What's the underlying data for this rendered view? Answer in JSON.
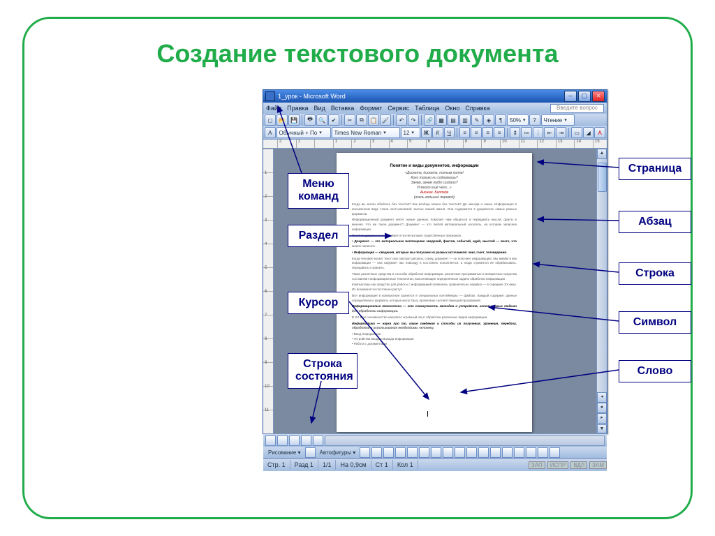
{
  "slide": {
    "title": "Создание текстового документа"
  },
  "word": {
    "title": "1_урок - Microsoft Word",
    "menu": {
      "file": "Файл",
      "edit": "Правка",
      "view": "Вид",
      "insert": "Вставка",
      "format": "Формат",
      "service": "Сервис",
      "table": "Таблица",
      "window": "Окно",
      "help": "Справка",
      "ask": "Введите вопрос"
    },
    "toolbar2": {
      "style": "Обычный + По",
      "font": "Times New Roman",
      "size": "12",
      "bold": "Ж",
      "italic": "К",
      "underline": "Ч"
    },
    "zoom": "50%",
    "reading": "Чтение",
    "ruler_marks": [
      "2",
      "1",
      "",
      "1",
      "2",
      "3",
      "4",
      "5",
      "6",
      "7",
      "8",
      "9",
      "10",
      "11",
      "12",
      "13",
      "14",
      "15"
    ],
    "ruler_v_marks": [
      "",
      "1",
      "2",
      "3",
      "4",
      "5",
      "6",
      "7",
      "8",
      "9",
      "10",
      "11"
    ],
    "draw": {
      "label": "Рисование",
      "autoshapes": "Автофигуры"
    },
    "status": {
      "page": "Стр. 1",
      "section": "Разд 1",
      "count": "1/1",
      "at": "На 0,9см",
      "line": "Ст 1",
      "col": "Кол 1",
      "ind1": "ЗАП",
      "ind2": "ИСПР",
      "ind3": "ВДЛ",
      "ind4": "ЗАМ"
    },
    "doc": {
      "title": "Понятие и виды документов, информации",
      "poem1": "«Дискета, дискета, полным полна!",
      "poem2": "Кого только ни содержишь?",
      "poem3": "Зачем, зачем тебя создали?",
      "poem4": "И много ещё чего...»",
      "poem5": "Аноним. Баллада",
      "poem6": "(очень вольный перевод)"
    }
  },
  "callouts": {
    "left1": "Меню\nкоманд",
    "left2": "Раздел",
    "left3": "Курсор",
    "left4": "Строка\nсостояния",
    "right1": "Страница",
    "right2": "Абзац",
    "right3": "Строка",
    "right4": "Символ",
    "right5": "Слово"
  }
}
